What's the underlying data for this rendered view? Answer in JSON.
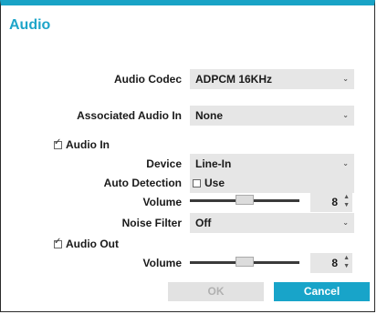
{
  "dialog": {
    "title": "Audio"
  },
  "audio_codec": {
    "label": "Audio Codec",
    "value": "ADPCM 16KHz"
  },
  "associated_audio_in": {
    "label": "Associated Audio In",
    "value": "None"
  },
  "audio_in": {
    "checkbox_label": "Audio In",
    "checked": true,
    "device": {
      "label": "Device",
      "value": "Line-In"
    },
    "auto_detection": {
      "label": "Auto Detection",
      "use_label": "Use",
      "checked": false
    },
    "volume": {
      "label": "Volume",
      "value": "8",
      "level": 0.5
    },
    "noise_filter": {
      "label": "Noise Filter",
      "value": "Off"
    }
  },
  "audio_out": {
    "checkbox_label": "Audio Out",
    "checked": true,
    "volume": {
      "label": "Volume",
      "value": "8",
      "level": 0.5
    }
  },
  "buttons": {
    "ok": "OK",
    "cancel": "Cancel"
  }
}
